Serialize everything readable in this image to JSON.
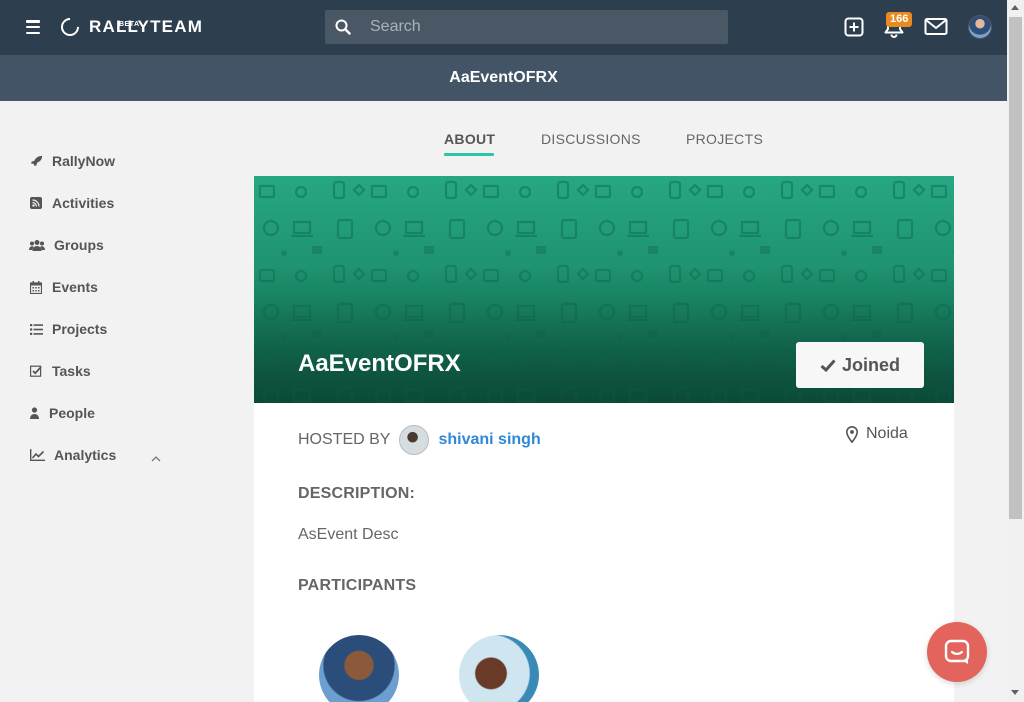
{
  "header": {
    "logo_text": "RALLYTEAM",
    "logo_beta": "BETA",
    "search_placeholder": "Search",
    "notification_count": "166"
  },
  "page_title": "AaEventOFRX",
  "sidebar": {
    "items": [
      {
        "label": "RallyNow",
        "icon": "rocket-icon"
      },
      {
        "label": "Activities",
        "icon": "rss-icon"
      },
      {
        "label": "Groups",
        "icon": "users-icon"
      },
      {
        "label": "Events",
        "icon": "calendar-icon"
      },
      {
        "label": "Projects",
        "icon": "list-icon"
      },
      {
        "label": "Tasks",
        "icon": "checkbox-icon"
      },
      {
        "label": "People",
        "icon": "user-icon"
      },
      {
        "label": "Analytics",
        "icon": "line-chart-icon"
      }
    ]
  },
  "tabs": [
    {
      "label": "ABOUT",
      "active": true
    },
    {
      "label": "DISCUSSIONS",
      "active": false
    },
    {
      "label": "PROJECTS",
      "active": false
    }
  ],
  "event": {
    "title": "AaEventOFRX",
    "joined_label": "Joined",
    "hosted_by_label": "HOSTED BY",
    "host_name": "shivani singh",
    "location": "Noida",
    "description_label": "DESCRIPTION:",
    "description": "AsEvent Desc",
    "participants_label": "PARTICIPANTS"
  },
  "colors": {
    "nav_bg": "#2d3e4f",
    "title_bar_bg": "#435466",
    "accent": "#2ec4a6",
    "banner_green": "#1b8c6a",
    "link_blue": "#2e88d6",
    "badge_orange": "#e88a20",
    "chat_red": "#e2645c"
  }
}
